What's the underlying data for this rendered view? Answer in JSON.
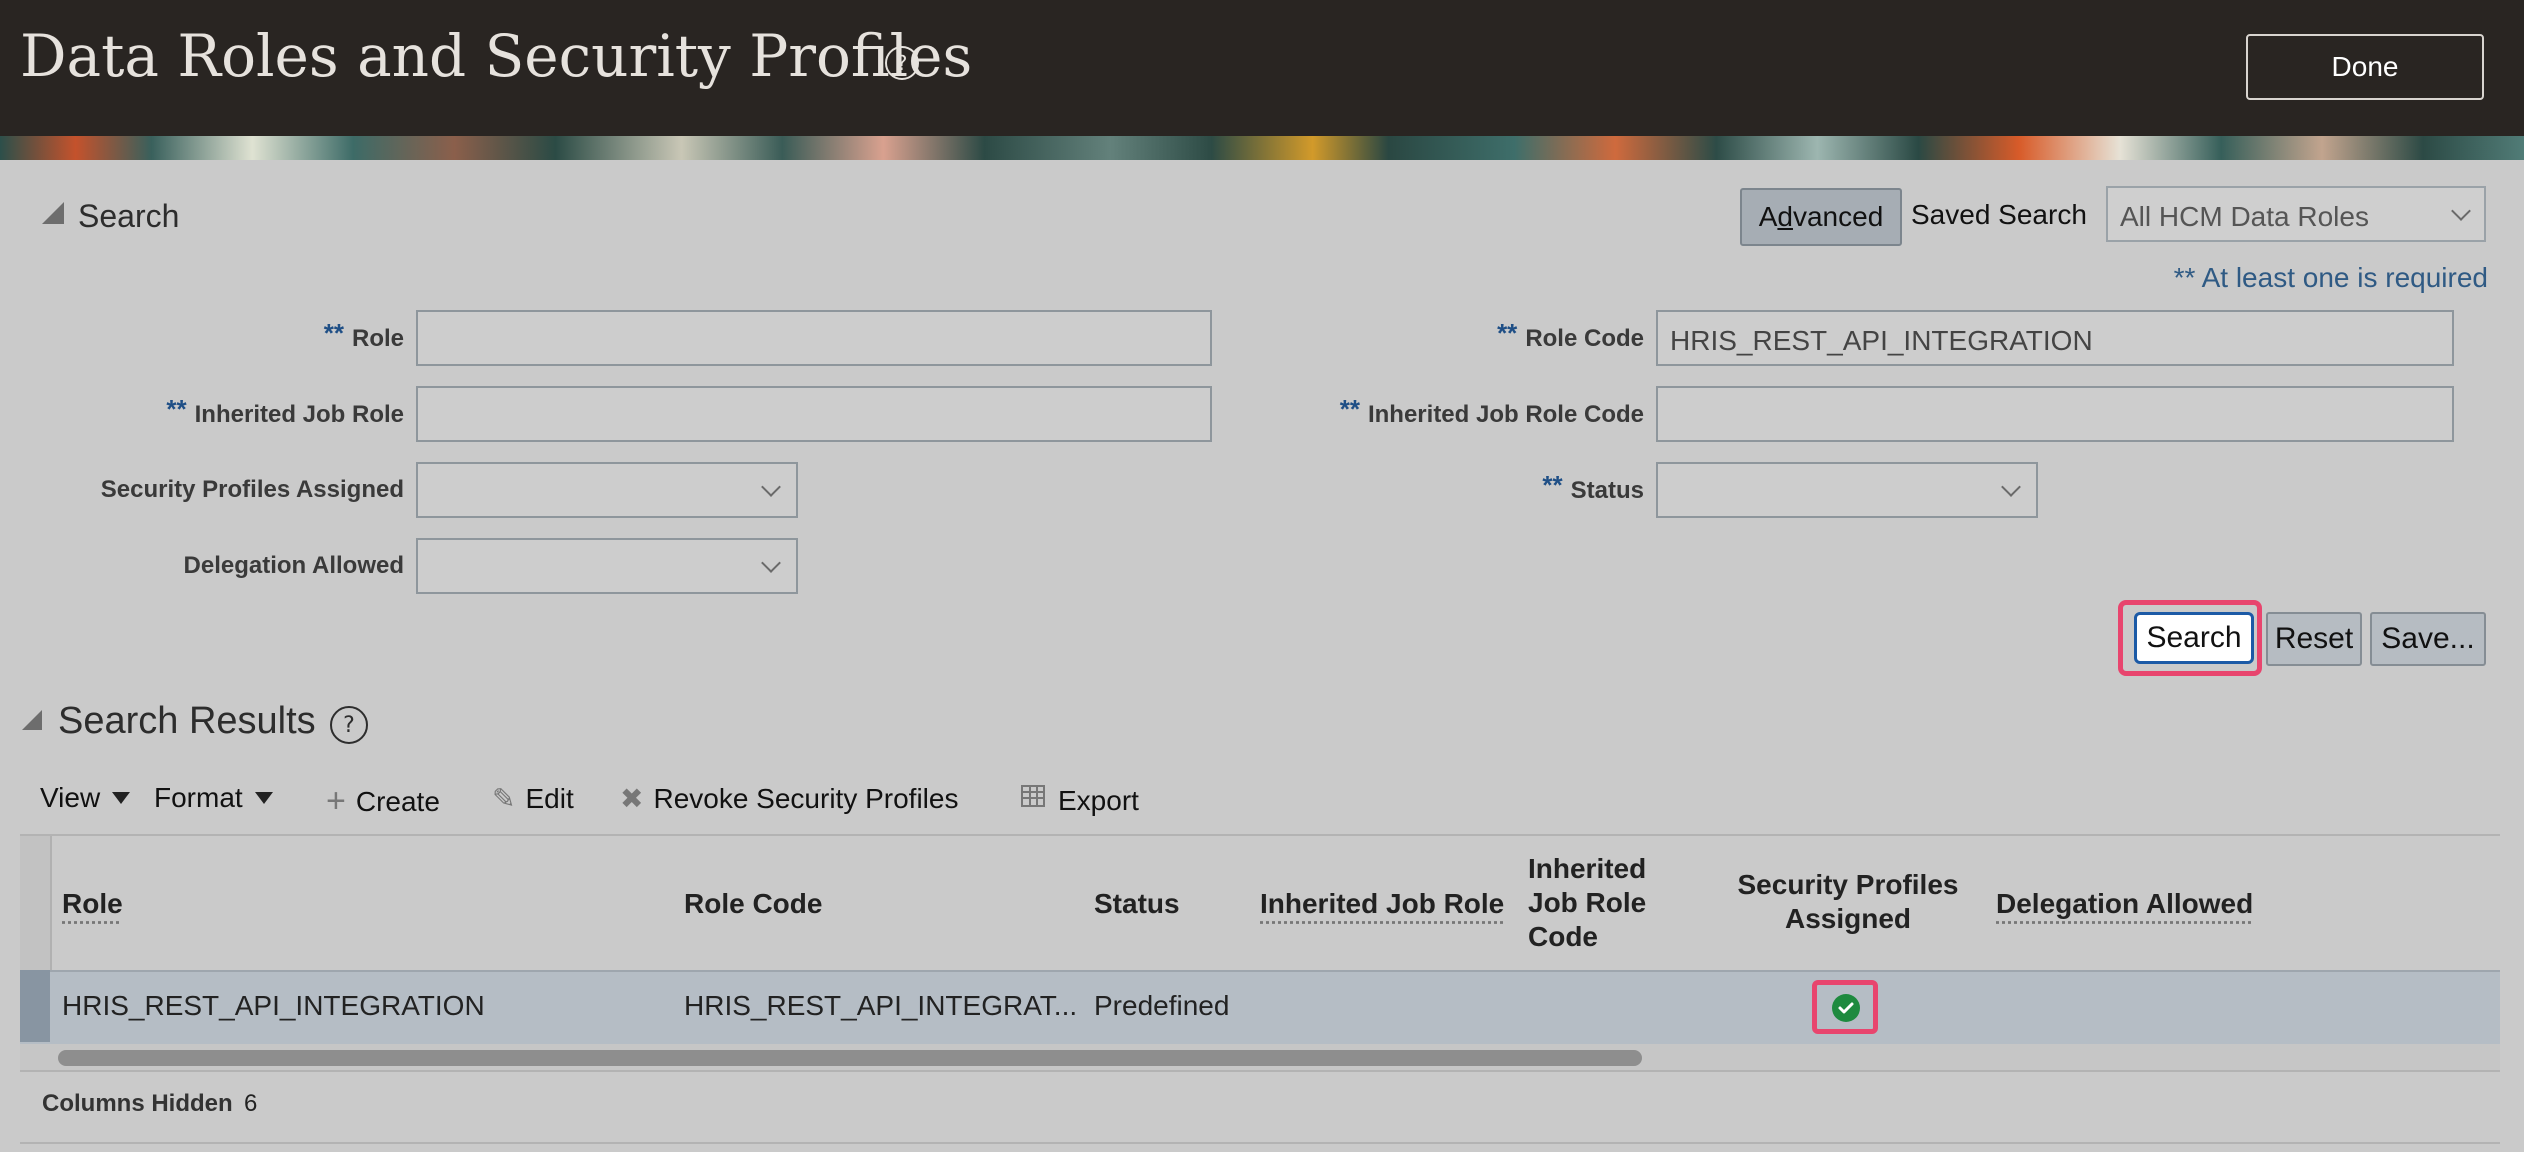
{
  "header": {
    "title": "Data Roles and Security Profiles",
    "help_icon": "question-circle-icon",
    "done_label": "Done"
  },
  "search": {
    "section_label": "Search",
    "advanced_label": "Advanced",
    "saved_search_label": "Saved Search",
    "saved_search_value": "All HCM Data Roles",
    "required_note": "** At least one is required",
    "required_marker": "**",
    "fields": {
      "role": {
        "label": "Role",
        "value": ""
      },
      "role_code": {
        "label": "Role Code",
        "value": "HRIS_REST_API_INTEGRATION"
      },
      "inherited_job_role": {
        "label": "Inherited Job Role",
        "value": ""
      },
      "inherited_job_role_code": {
        "label": "Inherited Job Role Code",
        "value": ""
      },
      "security_profiles_assigned": {
        "label": "Security Profiles Assigned",
        "value": ""
      },
      "status": {
        "label": "Status",
        "value": ""
      },
      "delegation_allowed": {
        "label": "Delegation Allowed",
        "value": ""
      }
    },
    "buttons": {
      "search": "Search",
      "reset": "Reset",
      "save": "Save..."
    }
  },
  "results": {
    "section_label": "Search Results",
    "toolbar": {
      "view": "View",
      "format": "Format",
      "create": "Create",
      "edit": "Edit",
      "revoke": "Revoke Security Profiles",
      "export": "Export"
    },
    "columns": {
      "role": "Role",
      "role_code": "Role Code",
      "status": "Status",
      "inherited_job_role": "Inherited Job Role",
      "inherited_job_role_code": "Inherited Job Role Code",
      "security_profiles_assigned": "Security Profiles Assigned",
      "delegation_allowed": "Delegation Allowed"
    },
    "rows": [
      {
        "role": "HRIS_REST_API_INTEGRATION",
        "role_code": "HRIS_REST_API_INTEGRAT...",
        "status": "Predefined",
        "inherited_job_role": "",
        "inherited_job_role_code": "",
        "security_profiles_assigned": "check-circle-icon",
        "delegation_allowed": ""
      }
    ],
    "footer": {
      "columns_hidden_label": "Columns Hidden",
      "columns_hidden_value": "6"
    }
  },
  "colors": {
    "header_bg": "#292522",
    "page_bg": "#cacaca",
    "highlight": "#e8456e",
    "accent_blue": "#1c5aa6",
    "success_green": "#1e8a3f"
  }
}
